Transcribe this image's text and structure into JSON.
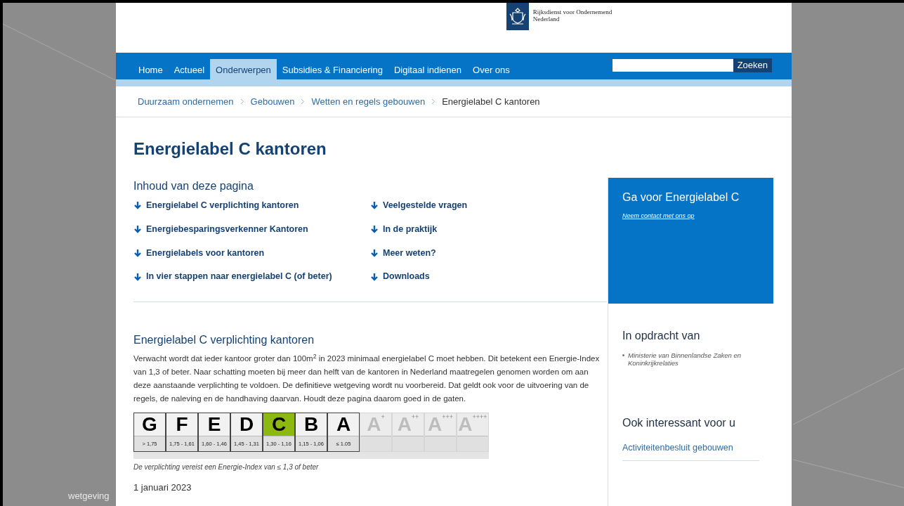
{
  "slide": {
    "caption": "wetgeving"
  },
  "header": {
    "logo_lines": [
      "Rijksdienst voor Ondernemend",
      "Nederland"
    ]
  },
  "nav": [
    {
      "label": "Home",
      "selected": false
    },
    {
      "label": "Actueel",
      "selected": false
    },
    {
      "label": "Onderwerpen",
      "selected": true
    },
    {
      "label": "Subsidies & Financiering",
      "selected": false
    },
    {
      "label": "Digitaal indienen",
      "selected": false
    },
    {
      "label": "Over ons",
      "selected": false
    }
  ],
  "search": {
    "button": "Zoeken"
  },
  "breadcrumb": [
    {
      "label": "Duurzaam ondernemen",
      "current": false
    },
    {
      "label": "Gebouwen",
      "current": false
    },
    {
      "label": "Wetten en regels gebouwen",
      "current": false
    },
    {
      "label": "Energielabel C kantoren",
      "current": true
    }
  ],
  "title": "Energielabel C kantoren",
  "toc": {
    "heading": "Inhoud van deze pagina",
    "columns": [
      [
        "Energielabel C verplichting kantoren",
        "Energiebesparingsverkenner Kantoren",
        "Energielabels voor kantoren",
        "In vier stappen naar energielabel C (of beter)"
      ],
      [
        "Veelgestelde vragen",
        "In de praktijk",
        "Meer weten?",
        "Downloads"
      ]
    ]
  },
  "section": {
    "heading": "Energielabel C verplichting kantoren",
    "paragraph": "Verwacht wordt dat ieder kantoor groter dan 100m$^{2}$ in 2023 minimaal energielabel C moet hebben. Dit betekent een Energie-Index van 1,3 of beter. Naar schatting moeten bij meer dan helft van de kantoren in Nederland maatregelen genomen worden om aan deze aanstaande verplichting te voldoen. De definitieve wetgeving wordt nu voorbereid. Dat geldt ook voor de uitvoering van de regels, de naleving en de handhaving daarvan. Houdt deze pagina daarom goed in de gaten.",
    "label_scale": [
      {
        "letter": "G",
        "range": "> 1,75",
        "selected": false,
        "disabled": false
      },
      {
        "letter": "F",
        "range": "1,75 - 1,61",
        "selected": false,
        "disabled": false
      },
      {
        "letter": "E",
        "range": "1,60 - 1,46",
        "selected": false,
        "disabled": false
      },
      {
        "letter": "D",
        "range": "1,45 - 1,31",
        "selected": false,
        "disabled": false
      },
      {
        "letter": "C",
        "range": "1,30 - 1,16",
        "selected": true,
        "disabled": false
      },
      {
        "letter": "B",
        "range": "1,15 - 1,06",
        "selected": false,
        "disabled": false
      },
      {
        "letter": "A",
        "range": "≤ 1.05",
        "selected": false,
        "disabled": false
      },
      {
        "letter": "A",
        "plus": "+",
        "selected": false,
        "disabled": true
      },
      {
        "letter": "A",
        "plus": "++",
        "selected": false,
        "disabled": true
      },
      {
        "letter": "A",
        "plus": "+++",
        "selected": false,
        "disabled": true
      },
      {
        "letter": "A",
        "plus": "++++",
        "selected": false,
        "disabled": true
      }
    ],
    "caption": "De verplichting vereist een Energie-Index van ≤ 1,3 of beter",
    "date": "1 januari 2023"
  },
  "sidebar": {
    "cta": {
      "title": "Ga voor Energielabel C",
      "link": "Neem contact met ons op"
    },
    "commissioned": {
      "heading": "In opdracht van",
      "items": [
        "Ministerie van Binnenlandse Zaken en Koninkrijkrelaties"
      ]
    },
    "related": {
      "heading": "Ook interessant voor u",
      "links": [
        "Activiteitenbesluit gebouwen"
      ]
    }
  }
}
